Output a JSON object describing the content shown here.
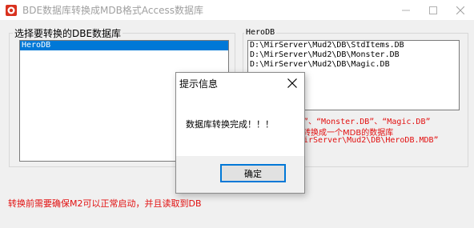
{
  "window": {
    "title": "BDE数据库转换成MDB格式Access数据库",
    "icon": "app-icon"
  },
  "left_group": {
    "label": "选择要转换的DBE数据库",
    "items": [
      "HeroDB"
    ],
    "selected_index": 0
  },
  "right_group": {
    "label": "HeroDB",
    "paths": [
      "D:\\MirServer\\Mud2\\DB\\StdItems.DB",
      "D:\\MirServer\\Mud2\\DB\\Monster.DB",
      "D:\\MirServer\\Mud2\\DB\\Magic.DB"
    ],
    "info_lines": [
      "B”、“Monster.DB”、“Magic.DB”",
      "转换成一个MDB的数据库",
      "irServer\\Mud2\\DB\\HeroDB.MDB”"
    ]
  },
  "bottom_note": "转换前需要确保M2可以正常启动，并且读取到DB",
  "dialog": {
    "title": "提示信息",
    "message": "数据库转换完成！！！",
    "ok_label": "确定"
  },
  "colors": {
    "accent": "#0078d7",
    "warning_text": "#e21010",
    "title_inactive": "#a0a0a0"
  }
}
